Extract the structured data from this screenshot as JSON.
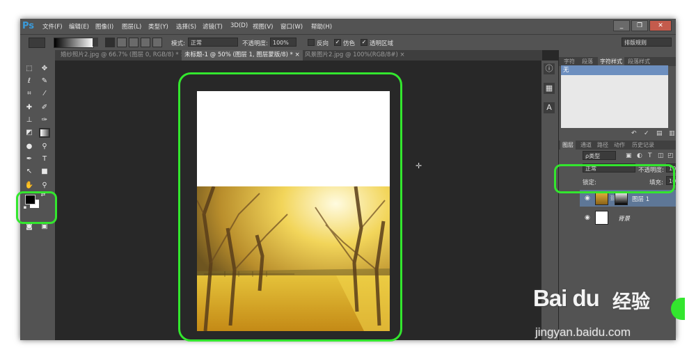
{
  "app": {
    "logo": "Ps",
    "menu": [
      "文件(F)",
      "编辑(E)",
      "图像(I)",
      "图层(L)",
      "类型(Y)",
      "选择(S)",
      "滤镜(T)",
      "3D(D)",
      "视图(V)",
      "窗口(W)",
      "帮助(H)"
    ],
    "window_buttons": [
      "_",
      "❐",
      "✕"
    ]
  },
  "options_bar": {
    "mode_label": "模式:",
    "mode_value": "正常",
    "opacity_label": "不透明度:",
    "opacity_value": "100%",
    "reverse_label": "反向",
    "dither_label": "仿色",
    "transparency_label": "透明区域",
    "workspace_value": "排版规则"
  },
  "doc_tabs": [
    {
      "label": "婚纱照片2.jpg @ 66.7% (图层 0, RGB/8) *",
      "close": "×"
    },
    {
      "label": "未标题-1 @ 50% (图层 1, 图层蒙版/8) *",
      "close": "×"
    },
    {
      "label": "风景图片2.jpg @ 100%(RGB/8#)",
      "close": "×"
    }
  ],
  "panels": {
    "char_tabs": [
      "字符",
      "段落",
      "字符样式",
      "段落样式"
    ],
    "style_none": "无",
    "layer_tabs": [
      "图层",
      "通道",
      "路径",
      "动作",
      "历史记录"
    ],
    "kind_label": "ρ类型",
    "blend_value": "正常",
    "opacity_label": "不透明度:",
    "opacity_value": "100%",
    "lock_label": "锁定:",
    "fill_label": "填充:",
    "fill_value": "100%",
    "layers": [
      {
        "name": "图层 1"
      },
      {
        "name": "背景"
      }
    ]
  },
  "watermark": {
    "brand": "Bai du",
    "cn": "经验",
    "url": "jingyan.baidu.com"
  },
  "colors": {
    "highlight": "#33e62e",
    "selected_layer": "#5e7797",
    "foreground": "#000000",
    "background": "#ffffff"
  }
}
